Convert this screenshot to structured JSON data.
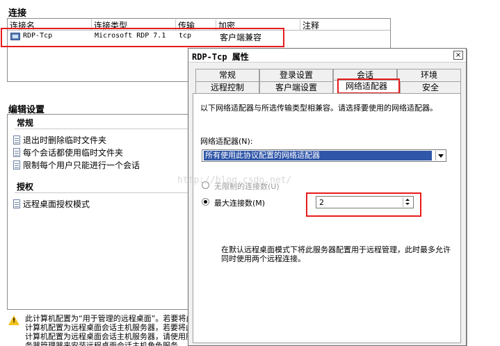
{
  "connections": {
    "section_title": "连接",
    "columns": [
      "连接名",
      "连接类型",
      "传输",
      "加密",
      "注释"
    ],
    "rows": [
      {
        "name": "RDP-Tcp",
        "type": "Microsoft RDP 7.1",
        "transport": "tcp",
        "encryption": "客户端兼容",
        "comment": ""
      }
    ]
  },
  "edit_settings": {
    "section_title": "编辑设置",
    "groups": [
      {
        "title": "常规",
        "items": [
          "退出时删除临时文件夹",
          "每个会话都使用临时文件夹",
          "限制每个用户只能进行一个会话"
        ]
      },
      {
        "title": "授权",
        "items": [
          "远程桌面授权模式"
        ]
      }
    ]
  },
  "warning": {
    "icon": "warning-icon",
    "text": "此计算机配置为“用于管理的远程桌面”。若要将此计算机配置为远程桌面会话主机服务器，若要将此计算机配置为远程桌面会话主机服务器，请使用服务器管理器来安装远程桌面会话主机角色服务。"
  },
  "dialog": {
    "title": "RDP-Tcp 属性",
    "close_label": "×",
    "tabs_row1": [
      "常规",
      "登录设置",
      "会话",
      "环境"
    ],
    "tabs_row2": [
      "远程控制",
      "客户端设置",
      "网络适配器",
      "安全"
    ],
    "active_tab": "网络适配器",
    "description": "以下网络适配器与所选传输类型相兼容。请选择要使用的网络适配器。",
    "adapter_label": "网络适配器(N):",
    "adapter_value": "所有使用此协议配置的网络适配器",
    "radio_unlimited": "无限制的连接数(U)",
    "radio_max": "最大连接数(M)",
    "max_connections": "2",
    "note": "在默认远程桌面模式下将此服务器配置用于远程管理，此时最多允许同时使用两个远程连接。"
  },
  "watermark": "http://blog.csdn.net/",
  "colors": {
    "highlight_red": "#e81a1a",
    "selection_blue": "#2f56a8",
    "warning_yellow": "#f1c21b"
  }
}
